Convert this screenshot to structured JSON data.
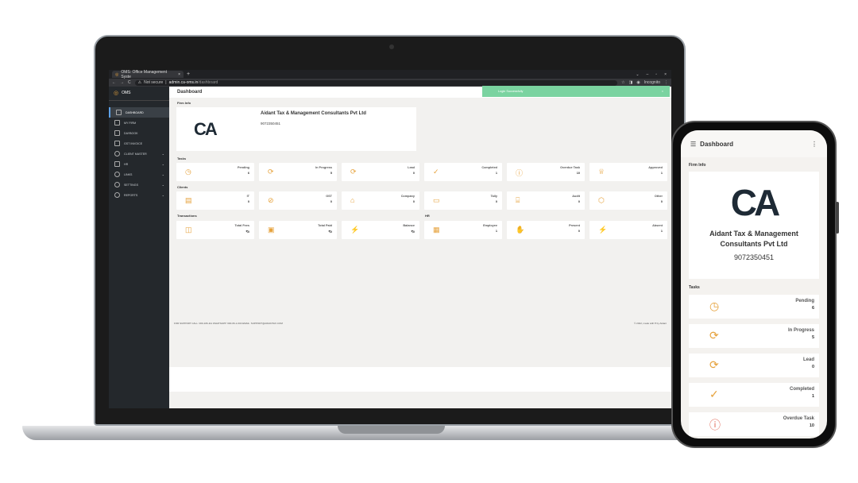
{
  "browser": {
    "tab_title": "OMS: Office Management Syste",
    "tab_close": "×",
    "new_tab": "+",
    "nav_back": "←",
    "nav_forward": "→",
    "nav_reload": "C",
    "security": "Not secure",
    "url_host": "admin.ca-oms.in",
    "url_path": "/dashboard",
    "profile_label": "Incognito"
  },
  "sidebar": {
    "app_name": "OMS",
    "items": [
      {
        "label": "DASHBOARD",
        "active": true
      },
      {
        "label": "MY FIRM"
      },
      {
        "label": "DAYBOOK"
      },
      {
        "label": "GST INVOICE"
      },
      {
        "label": "CLIENT MASTER",
        "chevron": "⌄"
      },
      {
        "label": "HR",
        "chevron": "⌄"
      },
      {
        "label": "LINKS",
        "chevron": "⌄"
      },
      {
        "label": "SETTINGS",
        "chevron": "⌄"
      },
      {
        "label": "REPORTS",
        "chevron": "⌄"
      }
    ]
  },
  "main": {
    "page_title": "Dashboard",
    "toast": {
      "message": "Login Successfully",
      "close": "×"
    },
    "firm_info_label": "Firm Info",
    "firm": {
      "name": "Aidant Tax & Management Consultants Pvt Ltd",
      "phone": "9072350451",
      "logo_text": "CA"
    },
    "tasks_label": "Tasks",
    "tasks": [
      {
        "label": "Pending",
        "value": "6",
        "icon": "clock-icon"
      },
      {
        "label": "In Progress",
        "value": "5",
        "icon": "refresh-icon"
      },
      {
        "label": "Lead",
        "value": "0",
        "icon": "refresh-icon"
      },
      {
        "label": "Completed",
        "value": "1",
        "icon": "check-icon"
      },
      {
        "label": "Overdue Task",
        "value": "10",
        "icon": "info-icon"
      },
      {
        "label": "Approved",
        "value": "1",
        "icon": "trophy-icon"
      }
    ],
    "clients_label": "Clients",
    "clients": [
      {
        "label": "IT",
        "value": "0"
      },
      {
        "label": "GST",
        "value": "0"
      },
      {
        "label": "Company",
        "value": "0"
      },
      {
        "label": "Tally",
        "value": "0"
      },
      {
        "label": "Audit",
        "value": "0"
      },
      {
        "label": "Other",
        "value": "0"
      }
    ],
    "transactions_label": "Transactions",
    "hr_label": "HR",
    "transactions": [
      {
        "label": "Total Fees",
        "value": "₹0"
      },
      {
        "label": "Total Paid",
        "value": "₹0"
      },
      {
        "label": "Balance",
        "value": "₹0"
      }
    ],
    "hr": [
      {
        "label": "Employee",
        "value": "1"
      },
      {
        "label": "Present",
        "value": "0"
      },
      {
        "label": "Absent",
        "value": "1"
      }
    ],
    "footer": {
      "left": "FOR SUPPORT   CALL: 000-106-111   WHATSAPP: 600-06-1-043   EMAIL: SUPPORT@AIDANTAX.COM",
      "right": "© 2022, made with ♥ by Aidant"
    }
  },
  "phone": {
    "title": "Dashboard",
    "menu_icon": "☰",
    "more_icon": "⋮",
    "firm_info_label": "Firm Info",
    "firm_name": "Aidant Tax & Management Consultants Pvt Ltd",
    "firm_phone": "9072350451",
    "logo_text": "CA",
    "tasks_label": "Tasks",
    "tasks": [
      {
        "label": "Pending",
        "value": "6"
      },
      {
        "label": "In Progress",
        "value": "5"
      },
      {
        "label": "Lead",
        "value": "0"
      },
      {
        "label": "Completed",
        "value": "1"
      },
      {
        "label": "Overdue Task",
        "value": "10"
      }
    ]
  },
  "colors": {
    "accent": "#e6a23c",
    "toast": "#7ad3a0",
    "sidebar": "#24282c"
  }
}
